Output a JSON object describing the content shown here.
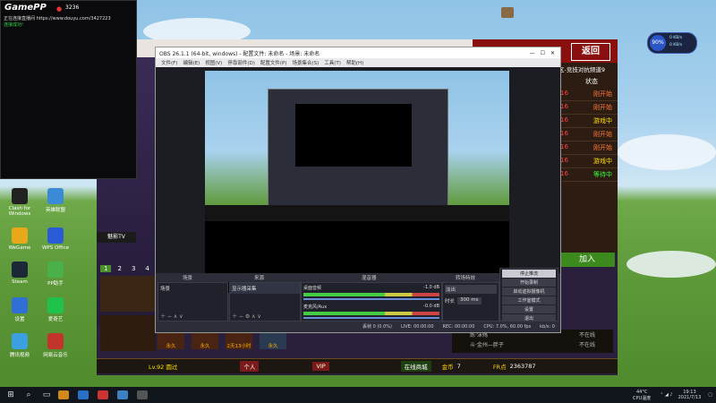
{
  "gamepp": {
    "brand": "GamePP",
    "value": "3236",
    "line1": "正在连接直播间 https://www.douyu.com/3427223",
    "line2": "连接成功!"
  },
  "desktop_icons": [
    {
      "label": "Clash for Windows",
      "color": "#222"
    },
    {
      "label": "英雄联盟",
      "color": "#3b8ad6"
    },
    {
      "label": "WeGame",
      "color": "#e8a81a"
    },
    {
      "label": "WPS Office",
      "color": "#2a5ad6"
    },
    {
      "label": "Steam",
      "color": "#1b2838"
    },
    {
      "label": "PP助手",
      "color": "#4ab04a"
    },
    {
      "label": "设置",
      "color": "#2f6fd6"
    },
    {
      "label": "爱奇艺",
      "color": "#1fc24b"
    },
    {
      "label": "腾讯视频",
      "color": "#3aa0e0"
    },
    {
      "label": "网易云音乐",
      "color": "#c3342a"
    }
  ],
  "obs": {
    "title": "OBS 26.1.1 (64-bit, windows) - 配置文件: 未命名 - 场景: 未命名",
    "menu": [
      "文件(F)",
      "编辑(E)",
      "视图(V)",
      "停靠部件(D)",
      "配置文件(P)",
      "场景集合(S)",
      "工具(T)",
      "帮助(H)"
    ],
    "docks": {
      "scenes": "场景",
      "sources": "来源",
      "mixer": "混音器",
      "transitions": "转场特效",
      "controls": "控件"
    },
    "scene_item": "场景",
    "source_item": "显示器采集",
    "mixer_channels": [
      {
        "name": "桌面音频",
        "value": "-1.0 dB"
      },
      {
        "name": "麦克风/Aux",
        "value": "-0.0 dB"
      }
    ],
    "transition": "淡出",
    "duration_label": "时长",
    "duration_value": "300 ms",
    "controls": [
      "停止推流",
      "开始录制",
      "启动虚拟摄像机",
      "工作室模式",
      "设置",
      "退出"
    ],
    "status": {
      "dropped": "丢帧 0 (0.0%)",
      "live": "LIVE: 00:00:00",
      "rec": "REC: 00:00:00",
      "cpu": "CPU: 7.0%, 60.00 fps",
      "kbps": "kb/s: 0"
    }
  },
  "game": {
    "back_label": "返回",
    "header_right": "区-竞技对抗频道9",
    "status_col": "状态",
    "rows": [
      {
        "id": "16",
        "status": "刚开始"
      },
      {
        "id": "16",
        "status": "刚开始"
      },
      {
        "id": "16",
        "status": "游戏中"
      },
      {
        "id": "16",
        "status": "刚开始"
      },
      {
        "id": "16",
        "status": "刚开始"
      },
      {
        "id": "16",
        "status": "游戏中"
      },
      {
        "id": "16",
        "status": "等待中"
      }
    ],
    "join": "加入",
    "tv_label": "魅影TV",
    "tabs": [
      "1",
      "2",
      "3",
      "4"
    ],
    "bottom_left": "Lv.92 圆过",
    "items_bar": [
      "永久",
      "永久",
      "2天13小时",
      "永久"
    ],
    "hidden_fast": "快速",
    "match_list": [
      {
        "name": "炼·沫殇",
        "status": "不在线"
      },
      {
        "name": "斗·金州—胖子",
        "status": "不在线"
      }
    ],
    "gold": "金币",
    "gold_value": "7",
    "fr_label": "FR点",
    "fr_value": "2363787",
    "vip": "VIP",
    "online_shop": "在线商城",
    "friend_label": "好友",
    "personal": "个人"
  },
  "netmeter": {
    "value": "90",
    "unit": "%",
    "up": "0 KB/s",
    "down": "0 KB/s"
  },
  "taskbar": {
    "temp": "44°C",
    "temp_label": "CPU温度",
    "time": "19:13",
    "date": "2021/7/13"
  }
}
